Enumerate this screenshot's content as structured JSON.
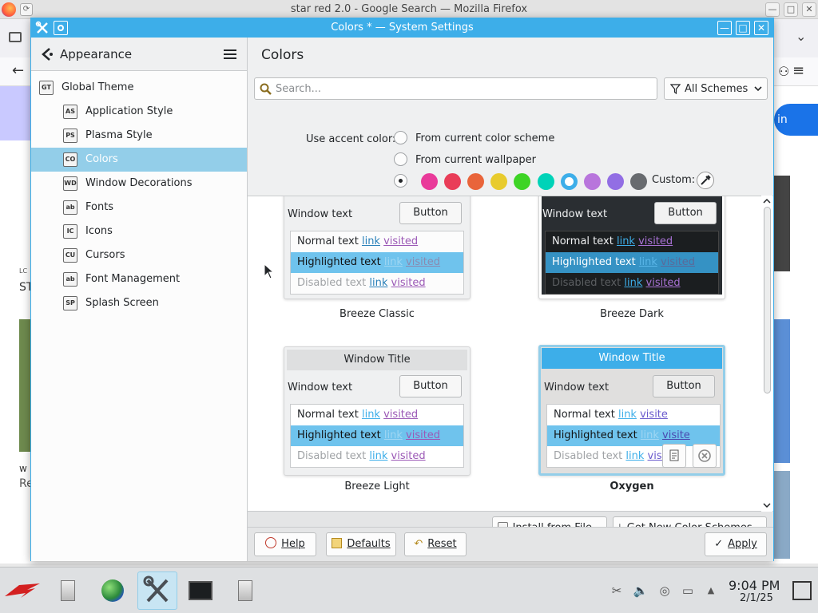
{
  "browser": {
    "title": "star red 2.0 - Google Search — Mozilla Firefox",
    "signin_fragment": "in",
    "fragment_lc": "LC",
    "fragment_st": "ST",
    "fragment_w": "w",
    "fragment_re": "Re"
  },
  "window": {
    "title": "Colors * — System Settings",
    "controls": {
      "minimize": "—",
      "maximize": "□",
      "close": "✕"
    }
  },
  "sidebar": {
    "header": "Appearance",
    "items": [
      {
        "label": "Global Theme",
        "selected": false
      },
      {
        "label": "Application Style",
        "selected": false
      },
      {
        "label": "Plasma Style",
        "selected": false
      },
      {
        "label": "Colors",
        "selected": true
      },
      {
        "label": "Window Decorations",
        "selected": false
      },
      {
        "label": "Fonts",
        "selected": false
      },
      {
        "label": "Icons",
        "selected": false
      },
      {
        "label": "Cursors",
        "selected": false
      },
      {
        "label": "Font Management",
        "selected": false
      },
      {
        "label": "Splash Screen",
        "selected": false
      }
    ]
  },
  "main": {
    "title": "Colors",
    "search_placeholder": "Search...",
    "filter_label": "All Schemes",
    "accent": {
      "label": "Use accent color:",
      "option_scheme": "From current color scheme",
      "option_wallpaper": "From current wallpaper",
      "custom_label": "Custom:",
      "swatches": [
        "#e93a9a",
        "#e93d58",
        "#e9643a",
        "#e8cb2d",
        "#3dd425",
        "#00d3b8",
        "#3daee9",
        "#b875dc",
        "#926ee4",
        "#686b6f"
      ],
      "selected_swatch": 6
    },
    "schemes": [
      {
        "name": "Breeze Classic",
        "window_title": "",
        "window_text": "Window text",
        "button": "Button",
        "normal": "Normal text",
        "highlighted": "Highlighted text",
        "disabled": "Disabled text",
        "link": "link",
        "visited": "visited",
        "current": false
      },
      {
        "name": "Breeze Dark",
        "window_title": "",
        "window_text": "Window text",
        "button": "Button",
        "normal": "Normal text",
        "highlighted": "Highlighted text",
        "disabled": "Disabled text",
        "link": "link",
        "visited": "visited",
        "current": false
      },
      {
        "name": "Breeze Light",
        "window_title": "Window Title",
        "window_text": "Window text",
        "button": "Button",
        "normal": "Normal text",
        "highlighted": "Highlighted text",
        "disabled": "Disabled text",
        "link": "link",
        "visited": "visited",
        "current": false
      },
      {
        "name": "Oxygen",
        "window_title": "Window Title",
        "window_text": "Window text",
        "button": "Button",
        "normal": "Normal text",
        "highlighted": "Highlighted text",
        "disabled": "Disabled text",
        "link": "link",
        "visited": "visite",
        "current": true
      }
    ],
    "install_label": "Install from File...",
    "get_new_label": "Get New Color Schemes..."
  },
  "footer": {
    "help": "Help",
    "defaults": "Defaults",
    "reset": "Reset",
    "apply": "Apply"
  },
  "taskbar": {
    "time": "9:04 PM",
    "date": "2/1/25"
  },
  "colors": {
    "accent": "#3daee9",
    "highlight": "#93cee9",
    "selection_row": "#6fc3ed",
    "dark_bg": "#2a2e32",
    "oxygen_title": "#3daee9"
  }
}
